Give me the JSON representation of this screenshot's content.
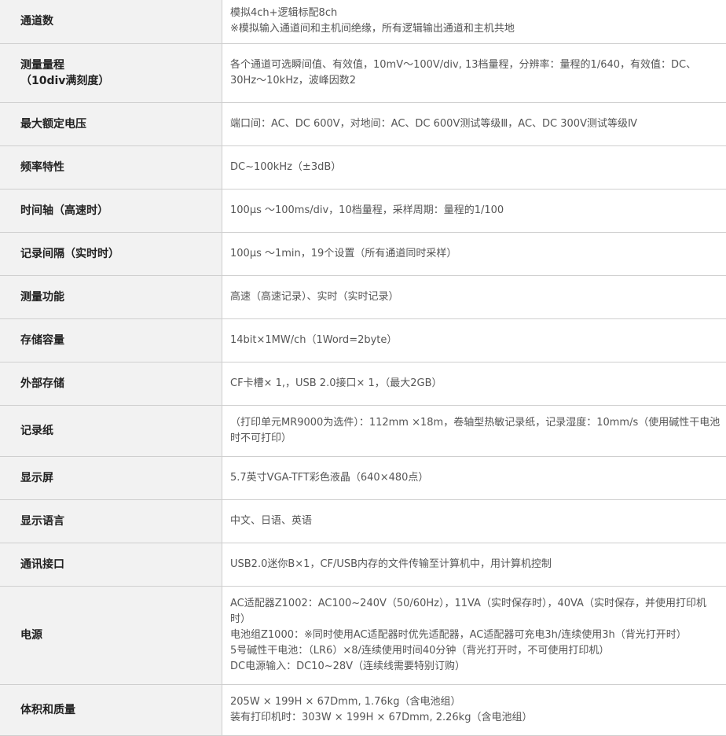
{
  "rows": [
    {
      "label": "通道数",
      "value": "模拟4ch+逻辑标配8ch\n※模拟输入通道间和主机间绝缘，所有逻辑输出通道和主机共地"
    },
    {
      "label": "测量量程\n（10div满刻度）",
      "value": "各个通道可选瞬间值、有效值，10mV～100V/div, 13档量程，分辨率：量程的1/640，有效值：DC、 30Hz～10kHz，波峰因数2"
    },
    {
      "label": "最大额定电压",
      "value": "端口间：AC、DC 600V，对地间：AC、DC 600V测试等级Ⅲ，AC、DC 300V测试等级Ⅳ"
    },
    {
      "label": "频率特性",
      "value": "DC~100kHz（±3dB）"
    },
    {
      "label": "时间轴（高速时）",
      "value": "100μs ～100ms/div，10档量程，采样周期：量程的1/100"
    },
    {
      "label": "记录间隔（实时时）",
      "value": "100μs ～1min，19个设置（所有通道同时采样）"
    },
    {
      "label": "测量功能",
      "value": "高速（高速记录）、实时（实时记录）"
    },
    {
      "label": "存储容量",
      "value": "14bit×1MW/ch（1Word=2byte）"
    },
    {
      "label": "外部存储",
      "value": "CF卡槽× 1,，USB 2.0接口× 1，（最大2GB）"
    },
    {
      "label": "记录纸",
      "value": "（打印单元MR9000为选件）：112mm ×18m，卷轴型热敏记录纸，记录湿度：10mm/s（使用碱性干电池时不可打印）"
    },
    {
      "label": "显示屏",
      "value": "5.7英寸VGA-TFT彩色液晶（640×480点）"
    },
    {
      "label": "显示语言",
      "value": "中文、日语、英语"
    },
    {
      "label": "通讯接口",
      "value": "USB2.0迷你B×1，CF/USB内存的文件传输至计算机中，用计算机控制"
    },
    {
      "label": "电源",
      "value": "AC适配器Z1002：AC100~240V（50/60Hz），11VA（实时保存时），40VA（实时保存，并使用打印机时）\n电池组Z1000：※同时使用AC适配器时优先适配器，AC适配器可充电3h/连续使用3h（背光打开时）\n5号碱性干电池：（LR6）×8/连续使用时间40分钟（背光打开时，不可使用打印机）\nDC电源输入：DC10~28V（连续线需要特别订购）"
    },
    {
      "label": "体积和质量",
      "value": "205W × 199H × 67Dmm, 1.76kg（含电池组）\n装有打印机时：303W × 199H × 67Dmm, 2.26kg（含电池组）"
    }
  ]
}
